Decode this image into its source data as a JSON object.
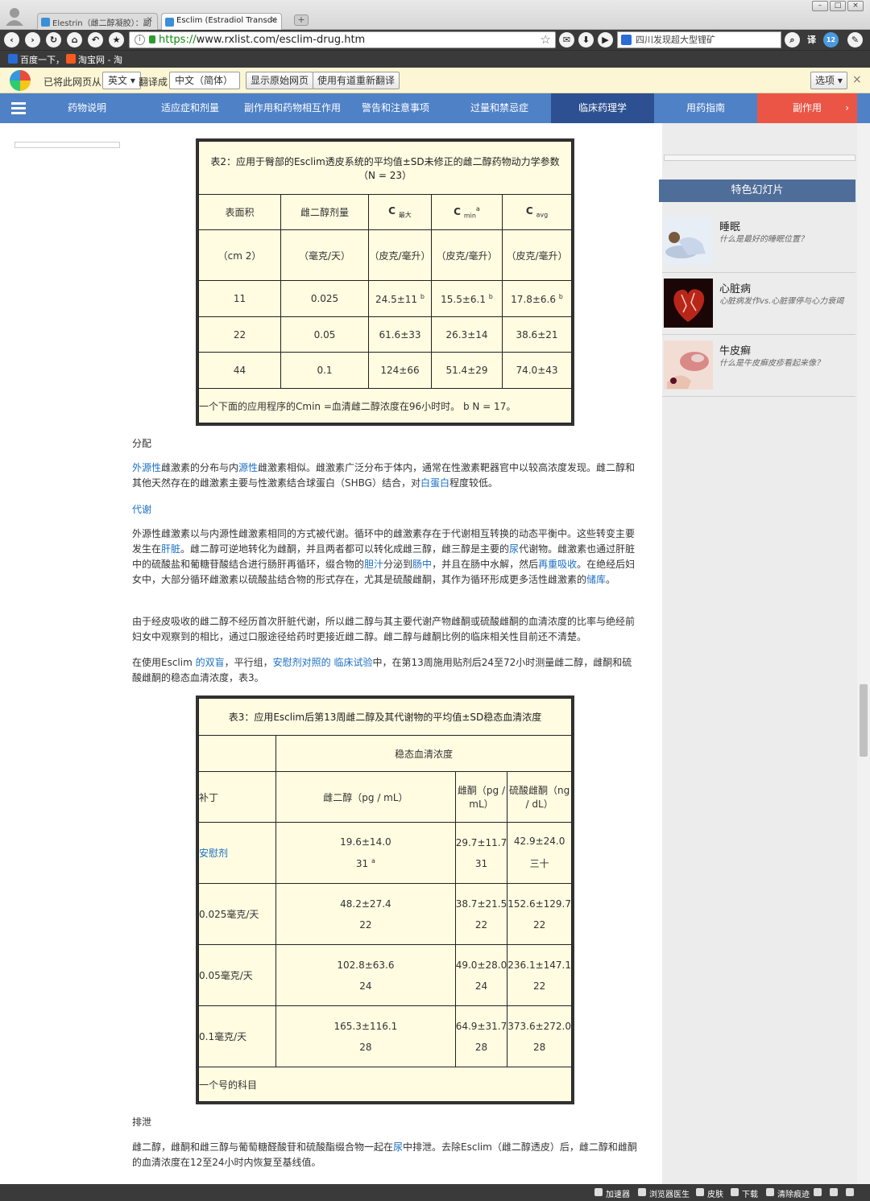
{
  "browser": {
    "tabs": [
      {
        "label": "Elestrin（雌二醇凝胶）：副"
      },
      {
        "label": "Esclim (Estradiol Transde"
      }
    ],
    "url_prefix": "https://",
    "url_rest": "www.rxlist.com/esclim-drug.htm",
    "search_text": "四川发现超大型锂矿",
    "badge": "12",
    "bookmarks": [
      "百度一下，",
      "淘宝网 - 淘"
    ]
  },
  "translate": {
    "prefix": "已将此网页从",
    "source_lang": "英文",
    "mid": "翻译成",
    "target_lang": "中文（简体）",
    "show_original": "显示原始网页",
    "retranslate": "使用有道重新翻译",
    "options": "选项"
  },
  "sitenav": [
    "药物说明",
    "适应症和剂量",
    "副作用和药物相互作用",
    "警告和注意事项",
    "过量和禁忌症",
    "临床药理学",
    "用药指南",
    "副作用"
  ],
  "table2": {
    "title": "表2：应用于臀部的Esclim透皮系统的平均值±SD未修正的雌二醇药物动力学参数（N = 23）",
    "headers": [
      "表面积",
      "雌二醇剂量",
      "C",
      "C",
      "C"
    ],
    "header_subs": [
      "最大",
      "min",
      "avg"
    ],
    "header_sup": "a",
    "units": [
      "（cm 2）",
      "（毫克/天）",
      "（皮克/毫升）",
      "（皮克/毫升）",
      "（皮克/毫升）"
    ],
    "rows": [
      [
        "11",
        "0.025",
        "24.5±11",
        "15.5±6.1",
        "17.8±6.6"
      ],
      [
        "22",
        "0.05",
        "61.6±33",
        "26.3±14",
        "38.6±21"
      ],
      [
        "44",
        "0.1",
        "124±66",
        "51.4±29",
        "74.0±43"
      ]
    ],
    "sup_b": "b",
    "footnote": "一个下面的应用程序的Cmin =血清雌二醇浓度在96小时时。 b N = 17。"
  },
  "sections": {
    "distribution_head": "分配",
    "distribution_p": [
      "外源性",
      "雌激素的分布与内",
      "源性",
      "雌激素相似。雌激素广泛分布于体内，通常在性激素靶器官中以较高浓度发现。雌二醇和其他天然存在的雌激素主要与性激素结合球蛋白（SHBG）结合，对",
      "白蛋白",
      "程度较低。"
    ],
    "metabolism_head": "代谢",
    "metabolism_p": [
      "外源性雌激素以与内源性雌激素相同的方式被代谢。循环中的雌激素存在于代谢相互转换的动态平衡中。这些转变主要发生在",
      "肝脏",
      "。雌二醇可逆地转化为雌酮，并且两者都可以转化成雌三醇，雌三醇是主要的",
      "尿",
      "代谢物。雌激素也通过肝脏中的硫酸盐和葡糖苷酸结合进行肠肝再循环，缀合物的",
      "胆汁",
      "分泌到",
      "肠中",
      "，并且在肠中水解，然后",
      "再重吸收",
      "。在绝经后妇女中，大部分循环雌激素以硫酸盐结合物的形式存在，尤其是硫酸雌酮，其作为循环形成更多活性雌激素的",
      "储库",
      "。"
    ],
    "p3": "由于经皮吸收的雌二醇不经历首次肝脏代谢，所以雌二醇与其主要代谢产物雌酮或硫酸雌酮的血清浓度的比率与绝经前妇女中观察到的相比，通过口服途径给药时更接近雌二醇。雌二醇与雌酮比例的临床相关性目前还不清楚。",
    "p4": [
      "在使用Esclim ",
      "的双盲",
      "，平行组，",
      "安慰剂对照的",
      " ",
      "临床试验",
      "中，在第13周施用贴剂后24至72小时测量雌二醇，雌酮和硫酸雌酮的稳态血清浓度，表3。"
    ],
    "excretion_head": "排泄",
    "excretion_p": [
      "雌二醇，雌酮和雌三醇与葡萄糖醛酸苷和硫酸酯缀合物一起在",
      "尿",
      "中排泄。去除Esclim（雌二醇透皮）后，雌二醇和雌酮的血清浓度在12至24小时内恢复至基线值。"
    ]
  },
  "table3": {
    "title": "表3：应用Esclim后第13周雌二醇及其代谢物的平均值±SD稳态血清浓度",
    "group_header": "稳态血清浓度",
    "headers": [
      "补丁",
      "雌二醇（pg / mL）",
      "雌酮（pg / mL）",
      "硫酸雌酮（ng / dL）"
    ],
    "rows": [
      {
        "label": "安慰剂",
        "e2": "19.6±14.0",
        "e1": "29.7±11.7",
        "e1s": "42.9±24.0",
        "n1": "31",
        "n2": "31",
        "n3": "三十"
      },
      {
        "label": "0.025毫克/天",
        "e2": "48.2±27.4",
        "e1": "38.7±21.5",
        "e1s": "152.6±129.7",
        "n1": "22",
        "n2": "22",
        "n3": "22"
      },
      {
        "label": "0.05毫克/天",
        "e2": "102.8±63.6",
        "e1": "49.0±28.0",
        "e1s": "236.1±147.1",
        "n1": "24",
        "n2": "24",
        "n3": "22"
      },
      {
        "label": "0.1毫克/天",
        "e2": "165.3±116.1",
        "e1": "64.9±31.7",
        "e1s": "373.6±272.0",
        "n1": "28",
        "n2": "28",
        "n3": "28"
      }
    ],
    "sup_a": "a",
    "footnote": "一个号的科目"
  },
  "sidebar": {
    "header": "特色幻灯片",
    "slides": [
      {
        "title": "睡眠",
        "desc": "什么是最好的睡眠位置？"
      },
      {
        "title": "心脏病",
        "desc": "心脏病发作vs.心脏骤停与心力衰竭"
      },
      {
        "title": "牛皮癣",
        "desc": "什么是牛皮癣皮疹看起来像？"
      }
    ]
  },
  "status": [
    "加速器",
    "浏览器医生",
    "皮肤",
    "下载",
    "清除痕迹"
  ],
  "colors": {
    "nav": "#4f81c7",
    "nav_active": "#2c5091",
    "nav_side": "#ea5545",
    "table_bg": "#fffce1",
    "link": "#1a6fc4",
    "translate_bar": "#fdf6d4"
  }
}
